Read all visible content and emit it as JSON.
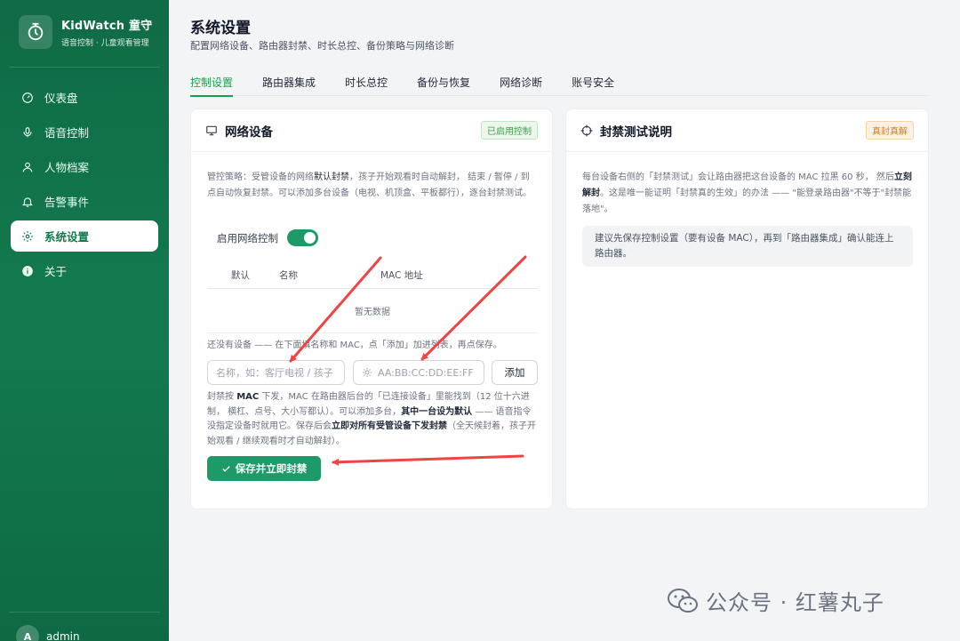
{
  "brand": {
    "title": "KidWatch 童守",
    "subtitle": "语音控制 · 儿童观看管理"
  },
  "nav": [
    {
      "label": "仪表盘",
      "icon": "dashboard-icon"
    },
    {
      "label": "语音控制",
      "icon": "microphone-icon"
    },
    {
      "label": "人物档案",
      "icon": "user-icon"
    },
    {
      "label": "告警事件",
      "icon": "bell-icon"
    },
    {
      "label": "系统设置",
      "icon": "gear-icon",
      "active": true
    },
    {
      "label": "关于",
      "icon": "info-icon"
    }
  ],
  "user": {
    "initial": "A",
    "name": "admin"
  },
  "page": {
    "title": "系统设置",
    "subtitle": "配置网络设备、路由器封禁、时长总控、备份策略与网络诊断"
  },
  "tabs": [
    "控制设置",
    "路由器集成",
    "时长总控",
    "备份与恢复",
    "网络诊断",
    "账号安全"
  ],
  "network_card": {
    "title": "网络设备",
    "badge": "已启用控制",
    "desc_1": "管控策略：受管设备的网络",
    "desc_2": "默认封禁",
    "desc_3": "，孩子开始观看时自动解封， 结束 / 暂停 / 到点自动恢复封禁。可以添加多台设备（电视、机顶盒、平板都行），逐台封禁测试。",
    "toggle_label": "启用网络控制",
    "toggle_on": true,
    "columns": [
      "默认",
      "名称",
      "MAC 地址"
    ],
    "empty_text": "暂无数据",
    "hint": "还没有设备 —— 在下面填名称和 MAC，点「添加」加进列表，再点保存。",
    "name_placeholder": "名称，如：客厅电视 / 孩子",
    "mac_placeholder": "AA:BB:CC:DD:EE:FF",
    "add_label": "添加",
    "note_1": "封禁按 ",
    "note_2": "MAC",
    "note_3": " 下发，MAC 在路由器后台的「已连接设备」里能找到（12 位十六进制， 横杠、点号、大小写都认）。可以添加多台，",
    "note_4": "其中一台设为默认",
    "note_5": " —— 语音指令没指定设备时就用它。保存后会",
    "note_6": "立即对所有受管设备下发封禁",
    "note_7": "（全天候封着，孩子开始观看 / 继续观看时才自动解封）。",
    "save_label": "保存并立即封禁"
  },
  "test_card": {
    "title": "封禁测试说明",
    "badge": "真封真解",
    "desc_1": "每台设备右侧的「封禁测试」会让路由器把这台设备的 MAC 拉黑 60 秒， 然后",
    "desc_2": "立刻解封",
    "desc_3": "。这是唯一能证明「封禁真的生效」的办法 —— \"能登录路由器\"不等于\"封禁能落地\"。",
    "tip": "建议先保存控制设置（要有设备 MAC），再到「路由器集成」确认能连上路由器。"
  },
  "watermark": "公众号 · 红薯丸子",
  "colors": {
    "sidebar": "#137a4f",
    "accent": "#1d9a67",
    "annotation_arrow": "#ef4444"
  }
}
